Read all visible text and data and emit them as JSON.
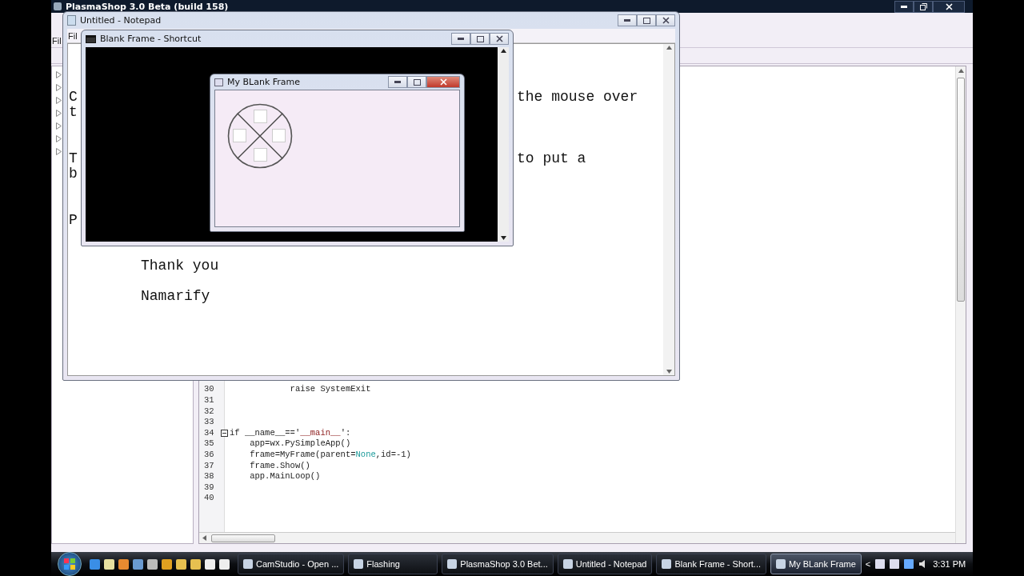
{
  "plasmashop": {
    "title": "PlasmaShop 3.0 Beta (build 158)",
    "menu": [
      "Fil"
    ],
    "tree_items": [
      {
        "expanded": false
      },
      {
        "expanded": false
      },
      {
        "expanded": false
      },
      {
        "expanded": false
      },
      {
        "expanded": false
      },
      {
        "expanded": false
      },
      {
        "expanded": false
      }
    ],
    "code_lines": [
      {
        "number": "30",
        "fold_start": false,
        "segments": [
          {
            "kind": "plain",
            "text": "            raise SystemExit"
          }
        ]
      },
      {
        "number": "31",
        "fold_start": false
      },
      {
        "number": "32",
        "fold_start": false
      },
      {
        "number": "33",
        "fold_start": false
      },
      {
        "number": "34",
        "fold_start": true,
        "segments": [
          {
            "kind": "plain",
            "text": "if __name__=='"
          },
          {
            "kind": "string",
            "text": "__main__"
          },
          {
            "kind": "plain",
            "text": "':"
          }
        ]
      },
      {
        "number": "35",
        "fold_start": false,
        "segments": [
          {
            "kind": "plain",
            "text": "    app=wx.PySimpleApp()"
          }
        ]
      },
      {
        "number": "36",
        "fold_start": false,
        "segments": [
          {
            "kind": "plain",
            "text": "    frame=MyFrame(parent="
          },
          {
            "kind": "constant",
            "text": "None"
          },
          {
            "kind": "plain",
            "text": ",id=-1)"
          }
        ]
      },
      {
        "number": "37",
        "fold_start": false,
        "segments": [
          {
            "kind": "plain",
            "text": "    frame.Show()"
          }
        ]
      },
      {
        "number": "38",
        "fold_start": false,
        "segments": [
          {
            "kind": "plain",
            "text": "    app.MainLoop()"
          }
        ]
      },
      {
        "number": "39",
        "fold_start": false
      },
      {
        "number": "40",
        "fold_start": false
      }
    ]
  },
  "notepad": {
    "title": "Untitled - Notepad",
    "menu": [
      "Fil"
    ],
    "lines": [
      {
        "kind": "split",
        "left": "C",
        "right": "the mouse over"
      },
      {
        "kind": "split",
        "left": "t"
      },
      {
        "kind": "blank"
      },
      {
        "kind": "blank"
      },
      {
        "kind": "split",
        "left": "T",
        "right": "to put a"
      },
      {
        "kind": "split",
        "left": "b"
      },
      {
        "kind": "blank"
      },
      {
        "kind": "blank"
      },
      {
        "kind": "split",
        "left": "P"
      },
      {
        "kind": "blank"
      },
      {
        "kind": "blank"
      },
      {
        "kind": "indented",
        "text": "Thank you"
      },
      {
        "kind": "blank"
      },
      {
        "kind": "indented",
        "text": "Namarify"
      }
    ]
  },
  "console": {
    "title": "Blank Frame - Shortcut"
  },
  "frame": {
    "title": "My BLank Frame"
  },
  "taskbar": {
    "tasks": [
      {
        "label": "CamStudio - Open ...",
        "selected": false
      },
      {
        "label": "Flashing",
        "selected": false
      },
      {
        "label": "PlasmaShop 3.0 Bet...",
        "selected": false
      },
      {
        "label": "Untitled - Notepad",
        "selected": false
      },
      {
        "label": "Blank Frame - Short...",
        "selected": false
      },
      {
        "label": "My BLank Frame",
        "selected": true
      }
    ],
    "tray_arrow": "<",
    "time": "3:31 PM"
  }
}
